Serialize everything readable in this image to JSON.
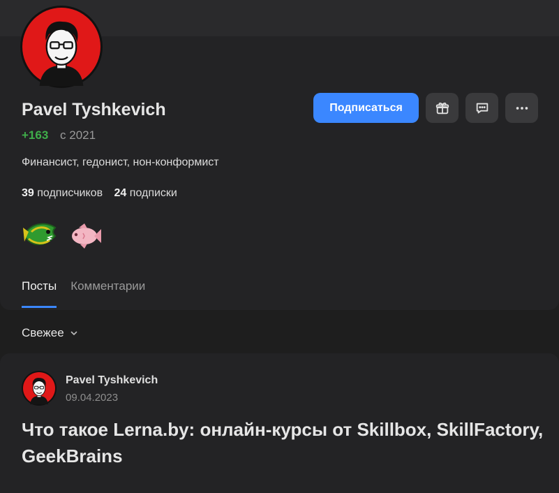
{
  "profile": {
    "name": "Pavel Tyshkevich",
    "rating": "+163",
    "since": "с 2021",
    "bio": "Финансист, гедонист, нон-конформист",
    "subscribers_count": "39",
    "subscribers_label": "подписчиков",
    "subscriptions_count": "24",
    "subscriptions_label": "подписки"
  },
  "actions": {
    "subscribe_label": "Подписаться",
    "gift_icon": "gift-icon",
    "message_icon": "chat-icon",
    "more_icon": "more-icon"
  },
  "badges": [
    "fish-green-icon",
    "fish-pink-icon"
  ],
  "tabs": [
    {
      "label": "Посты",
      "active": true
    },
    {
      "label": "Комментарии",
      "active": false
    }
  ],
  "sort": {
    "label": "Свежее"
  },
  "post": {
    "author": "Pavel Tyshkevich",
    "date": "09.04.2023",
    "title": "Что такое Lerna.by: онлайн-курсы от Skillbox, SkillFactory, GeekBrains"
  },
  "colors": {
    "accent": "#3b87ff",
    "rating": "#3fae4a",
    "card": "#232325",
    "background": "#1e1e1e"
  }
}
